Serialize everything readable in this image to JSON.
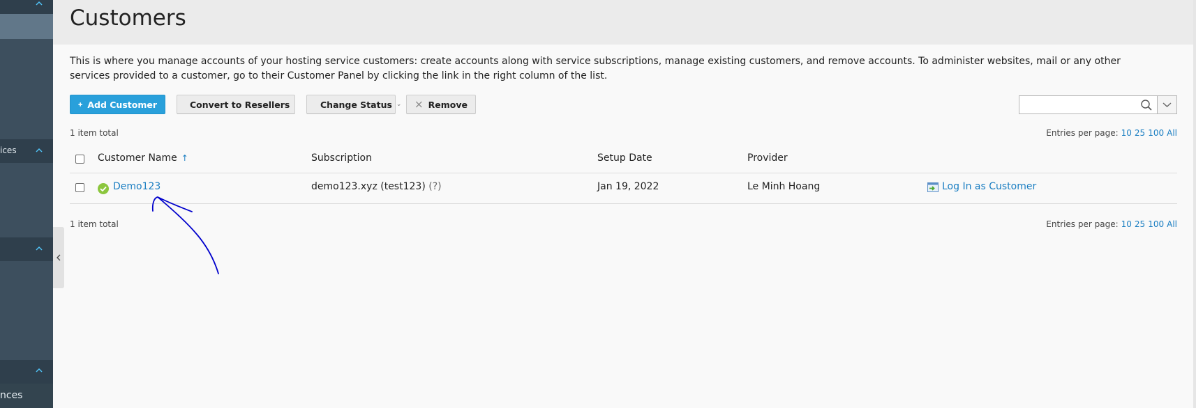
{
  "sidebar": {
    "items": [
      {
        "label": "ices"
      },
      {
        "label": "nces"
      }
    ]
  },
  "header": {
    "title": "Customers"
  },
  "description": "This is where you manage accounts of your hosting service customers: create accounts along with service subscriptions, manage existing customers, and remove accounts. To administer websites, mail or any other services provided to a customer, go to their Customer Panel by clicking the link in the right column of the list.",
  "toolbar": {
    "add_customer": "Add Customer",
    "convert_to_resellers": "Convert to Resellers",
    "change_status": "Change Status",
    "remove": "Remove"
  },
  "search": {
    "value": "",
    "placeholder": ""
  },
  "list": {
    "total_label": "1 item total",
    "entries_per_page_label": "Entries per page:",
    "page_sizes": [
      "10",
      "25",
      "100",
      "All"
    ],
    "columns": [
      "Customer Name",
      "Subscription",
      "Setup Date",
      "Provider"
    ],
    "sort_indicator": "↑",
    "rows": [
      {
        "customer_name": "Demo123",
        "subscription": "demo123.xyz (test123)",
        "subscription_help": "(?)",
        "setup_date": "Jan 19, 2022",
        "provider": "Le Minh Hoang",
        "action": "Log In as Customer",
        "status": "active"
      }
    ]
  },
  "colors": {
    "sidebar": "#3d4f5e",
    "primary_button": "#29a0db",
    "link": "#1a7ec2",
    "status_ok": "#8cc63e",
    "annotation": "#0000cc"
  }
}
